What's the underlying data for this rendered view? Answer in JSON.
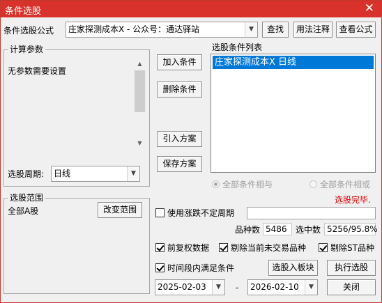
{
  "window": {
    "title": "条件选股",
    "close_glyph": "✕"
  },
  "toolbar": {
    "formula_label": "条件选股公式",
    "formula_value": "庄家探测成本X  -  公众号：通达驿站",
    "find_button": "查找",
    "usage_button": "用法注释",
    "view_formula_button": "查看公式"
  },
  "params": {
    "group_title": "计算参数",
    "no_params_text": "无参数需要设置",
    "period_label": "选股周期:",
    "period_value": "日线"
  },
  "actions": {
    "add_condition": "加入条件",
    "delete_condition": "删除条件",
    "import_plan": "引入方案",
    "save_plan": "保存方案"
  },
  "condition_list": {
    "title": "选股条件列表",
    "items": [
      "庄家探测成本X  日线"
    ]
  },
  "logic": {
    "all_and": "全部条件相与",
    "all_or": "全部条件相或",
    "selected": "all_and"
  },
  "status": {
    "text": "选股完毕.",
    "color": "#e00000"
  },
  "scope": {
    "group_title": "选股范围",
    "value": "全部A股",
    "change_button": "改变范围"
  },
  "options": {
    "variable_period_label": "使用涨跌不定周期",
    "variable_period_checked": false,
    "variable_period_value": "",
    "count_label": "品种数",
    "count_value": "5486",
    "selected_label": "选中数",
    "selected_value": "5256/95.8%",
    "forward_adjust_label": "前复权数据",
    "forward_adjust_checked": true,
    "exclude_untraded_label": "剔除当前未交易品种",
    "exclude_untraded_checked": true,
    "exclude_st_label": "剔除ST品种",
    "exclude_st_checked": true,
    "time_range_label": "时间段内满足条件",
    "time_range_checked": true
  },
  "dates": {
    "start": "2025-02-03",
    "separator": "-",
    "end": "2026-02-10"
  },
  "bottom": {
    "add_to_block": "选股入板块",
    "execute": "执行选股",
    "close": "关闭"
  },
  "colors": {
    "title_bar": "#d9312b",
    "selection": "#0078d7"
  }
}
